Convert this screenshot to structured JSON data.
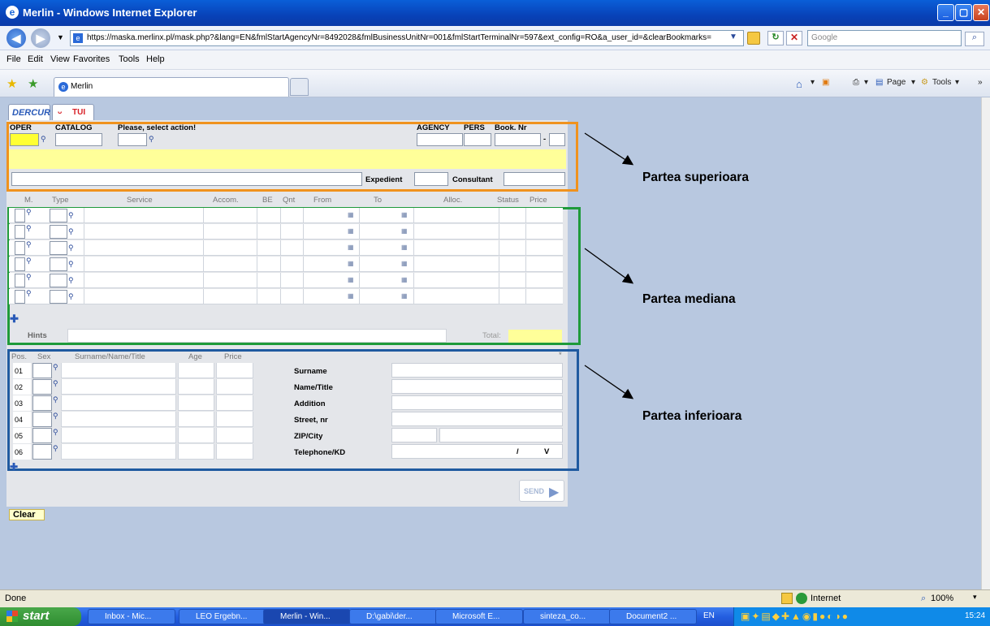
{
  "window": {
    "title": "Merlin - Windows Internet Explorer"
  },
  "address_bar": {
    "url": "https://maska.merlinx.pl/mask.php?&lang=EN&fmlStartAgencyNr=8492028&fmlBusinessUnitNr=001&fmlStartTerminalNr=597&ext_config=RO&a_user_id=&clearBookmarks=",
    "search_placeholder": "Google"
  },
  "menu": [
    "File",
    "Edit",
    "View",
    "Favorites",
    "Tools",
    "Help"
  ],
  "tab": {
    "label": "Merlin"
  },
  "toolbar": {
    "page": "Page",
    "tools": "Tools"
  },
  "brands": {
    "dercour": "DERCUR",
    "tui": "TUI"
  },
  "top_section": {
    "oper_label": "OPER",
    "catalog_label": "CATALOG",
    "action_prompt": "Please, select action!",
    "agency_label": "AGENCY",
    "pers_label": "PERS",
    "booknr_label": "Book. Nr",
    "expedient_label": "Expedient",
    "consultant_label": "Consultant",
    "dash": "-"
  },
  "services": {
    "columns": [
      "M.",
      "Type",
      "Service",
      "Accom.",
      "BE",
      "Qnt",
      "From",
      "To",
      "Alloc.",
      "Status",
      "Price"
    ],
    "hints_label": "Hints",
    "total_label": "Total:"
  },
  "travellers": {
    "columns": [
      "Pos.",
      "Sex",
      "Surname/Name/Title",
      "Age",
      "Price"
    ],
    "rows": [
      "01",
      "02",
      "03",
      "04",
      "05",
      "06"
    ],
    "asterisk": "*",
    "fields": [
      "Surname",
      "Name/Title",
      "Addition",
      "Street, nr",
      "ZIP/City",
      "Telephone/KD"
    ],
    "phone_sep": "/",
    "phone_v": "V"
  },
  "send_label": "SEND",
  "clear_label": "Clear",
  "annotations": {
    "top": "Partea superioara",
    "middle": "Partea mediana",
    "bottom": "Partea inferioara"
  },
  "status": {
    "text": "Done",
    "zone": "Internet",
    "zoom": "100%"
  },
  "taskbar": {
    "start": "start",
    "items": [
      "Inbox - Mic...",
      "LEO Ergebn...",
      "Merlin - Win...",
      "D:\\gabi\\der...",
      "Microsoft E...",
      "sinteza_co...",
      "Document2 ..."
    ],
    "lang": "EN",
    "clock": "15:24"
  },
  "colors": {
    "top_box": "#f0921e",
    "middle_box": "#1e9a3a",
    "bottom_box": "#1f5aa0",
    "highlight": "#ffff99"
  }
}
